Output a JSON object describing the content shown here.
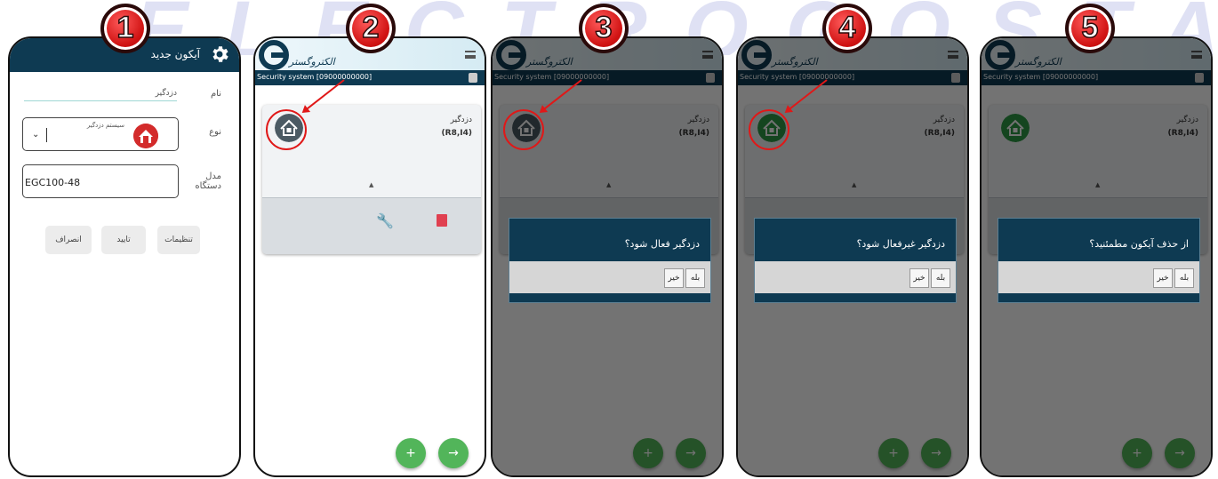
{
  "watermark": "ELECTROGOSTAR",
  "steps": [
    "1",
    "2",
    "3",
    "4",
    "5"
  ],
  "form": {
    "title": "آیکون جدید",
    "name_label": "نام",
    "name_value": "دزدگیر",
    "type_label": "نوع",
    "type_value": "سیستم دزدگیر",
    "model_label_line1": "مدل",
    "model_label_line2": "دستگاه",
    "model_value": "EGC100-48",
    "settings_button": "تنظیمات",
    "confirm_button": "تایید",
    "cancel_button": "انصراف"
  },
  "app": {
    "logo_text": "الکتروگستر",
    "status": "Security system   [09000000000]",
    "card_name": "دزدگیر",
    "card_code": "(R8,I4)",
    "add_icon": "+",
    "next_icon": "→"
  },
  "dialogs": {
    "activate": "دزدگیر فعال شود؟",
    "deactivate": "دزدگیر غیرفعال شود؟",
    "delete": "از حذف آیکون مطمئنید؟",
    "yes": "بله",
    "no": "خیر"
  },
  "colors": {
    "header": "#0e3a52",
    "accent_green": "#52b55a",
    "badge_red": "#d11414",
    "highlight_red": "#e01818"
  }
}
